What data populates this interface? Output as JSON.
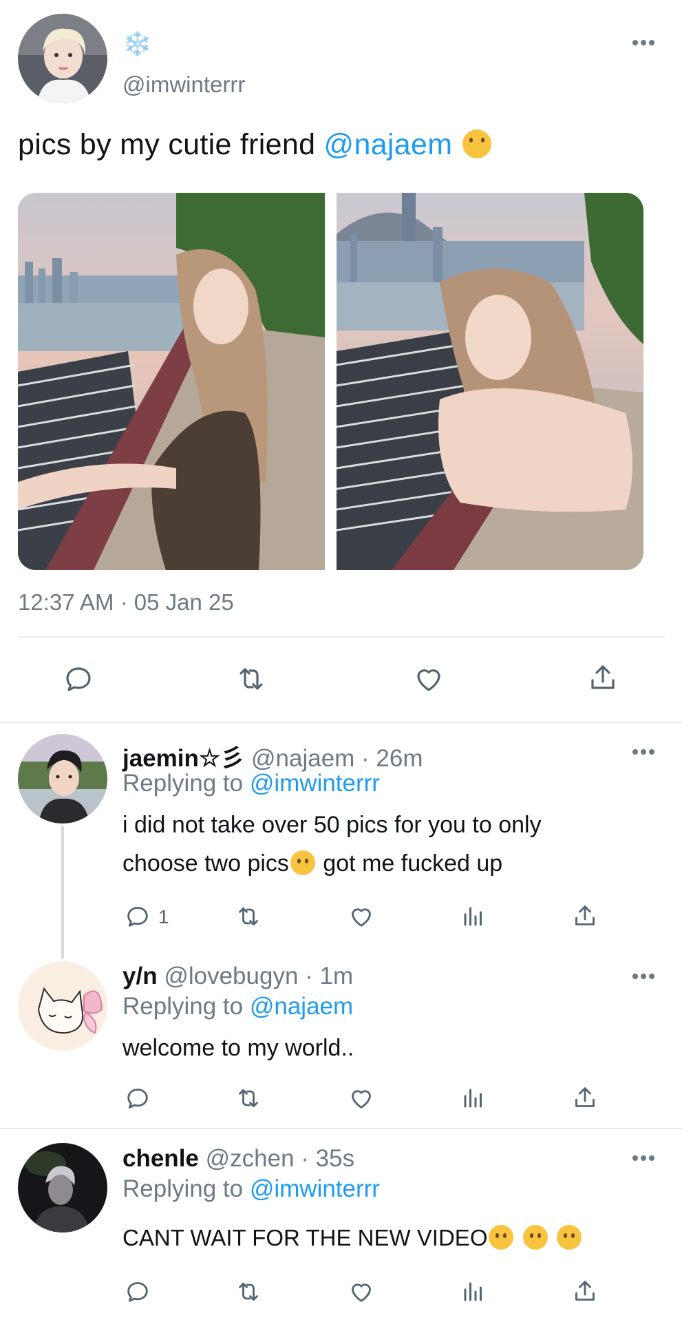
{
  "main": {
    "snowflake": "❄️",
    "handle": "@imwinterrr",
    "text_prefix": "pics by my cutie friend ",
    "mention": "@najaem",
    "timestamp": "12:37 AM · 05 Jan 25",
    "emoji": "🥹"
  },
  "replies": [
    {
      "name": "jaemin☆彡",
      "meta": "@najaem · 26m",
      "replying_prefix": "Replying to ",
      "replying_to": "@imwinterrr",
      "line1": "i did not take over 50 pics for you to only",
      "line2a": "choose two pics",
      "line2b": " got me fucked up",
      "reply_count": "1"
    },
    {
      "name": "y/n",
      "meta": "@lovebugyn · 1m",
      "replying_prefix": "Replying to ",
      "replying_to": "@najaem",
      "line1": "welcome to my world.."
    },
    {
      "name": "chenle",
      "meta": "@zchen · 35s",
      "replying_prefix": "Replying to ",
      "replying_to": "@imwinterrr",
      "line1": "CANT WAIT FOR THE NEW VIDEO"
    }
  ],
  "colors": {
    "link": "#1d9bf0",
    "muted": "#6b7a86",
    "divider": "#e6ecf0",
    "icon": "#536471"
  }
}
